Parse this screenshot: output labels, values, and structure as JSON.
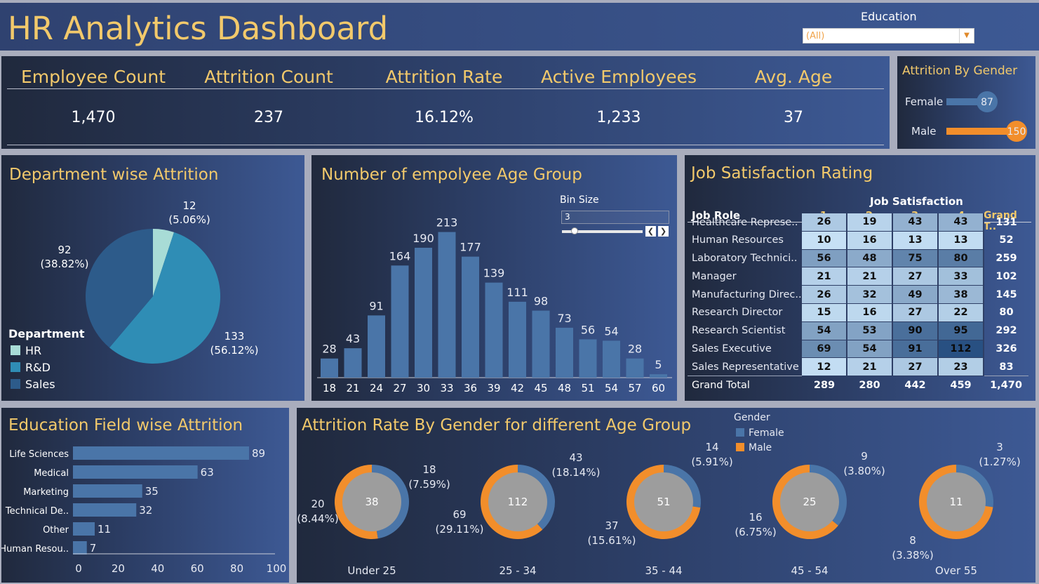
{
  "header": {
    "title": "HR Analytics Dashboard",
    "education_filter": {
      "label": "Education",
      "value": "(All)"
    }
  },
  "kpis": [
    {
      "label": "Employee Count",
      "value": "1,470"
    },
    {
      "label": "Attrition Count",
      "value": "237"
    },
    {
      "label": "Attrition Rate",
      "value": "16.12%"
    },
    {
      "label": "Active Employees",
      "value": "1,233"
    },
    {
      "label": "Avg. Age",
      "value": "37"
    }
  ],
  "attrition_by_gender": {
    "title": "Attrition By Gender",
    "items": [
      {
        "label": "Female",
        "value": 87
      },
      {
        "label": "Male",
        "value": 150
      }
    ],
    "colors": {
      "Female": "#4a75a8",
      "Male": "#f28e2b"
    }
  },
  "department": {
    "title": "Department wise Attrition",
    "legend_title": "Department",
    "chart_data": {
      "type": "pie",
      "categories": [
        "HR",
        "R&D",
        "Sales"
      ],
      "values": [
        12,
        133,
        92
      ],
      "labels": [
        "12",
        "133",
        "92"
      ],
      "percents": [
        "(5.06%)",
        "(56.12%)",
        "(38.82%)"
      ],
      "colors": [
        "#a8dcd6",
        "#2f8db5",
        "#2d5b8a"
      ]
    }
  },
  "age_group": {
    "title": "Number of empolyee Age Group",
    "bin_size": {
      "label": "Bin Size",
      "value": "3"
    },
    "chart_data": {
      "type": "bar",
      "categories": [
        "18",
        "21",
        "24",
        "27",
        "30",
        "33",
        "36",
        "39",
        "42",
        "45",
        "48",
        "51",
        "54",
        "57",
        "60"
      ],
      "values": [
        28,
        43,
        91,
        164,
        190,
        213,
        177,
        139,
        111,
        98,
        73,
        56,
        54,
        28,
        5
      ],
      "ylim": [
        0,
        230
      ],
      "color": "#4a75a8"
    }
  },
  "job_satisfaction": {
    "title": "Job Satisfaction Rating",
    "column_group": "Job Satisfaction",
    "row_header": "Job Role",
    "columns": [
      "1",
      "2",
      "3",
      "4",
      "Grand T.."
    ],
    "rows": [
      {
        "role": "Healthcare Represe..",
        "values": [
          "26",
          "19",
          "43",
          "43"
        ],
        "total": "131"
      },
      {
        "role": "Human Resources",
        "values": [
          "10",
          "16",
          "13",
          "13"
        ],
        "total": "52"
      },
      {
        "role": "Laboratory Technici..",
        "values": [
          "56",
          "48",
          "75",
          "80"
        ],
        "total": "259"
      },
      {
        "role": "Manager",
        "values": [
          "21",
          "21",
          "27",
          "33"
        ],
        "total": "102"
      },
      {
        "role": "Manufacturing Direc..",
        "values": [
          "26",
          "32",
          "49",
          "38"
        ],
        "total": "145"
      },
      {
        "role": "Research Director",
        "values": [
          "15",
          "16",
          "27",
          "22"
        ],
        "total": "80"
      },
      {
        "role": "Research Scientist",
        "values": [
          "54",
          "53",
          "90",
          "95"
        ],
        "total": "292"
      },
      {
        "role": "Sales Executive",
        "values": [
          "69",
          "54",
          "91",
          "112"
        ],
        "total": "326"
      },
      {
        "role": "Sales Representative",
        "values": [
          "12",
          "21",
          "27",
          "23"
        ],
        "total": "83"
      }
    ],
    "grand_total": {
      "label": "Grand Total",
      "values": [
        "289",
        "280",
        "442",
        "459"
      ],
      "total": "1,470"
    }
  },
  "education_field": {
    "title": "Education Field wise Attrition",
    "chart_data": {
      "type": "bar",
      "orientation": "horizontal",
      "categories": [
        "Life Sciences",
        "Medical",
        "Marketing",
        "Technical De..",
        "Other",
        "Human Resou.."
      ],
      "values": [
        89,
        63,
        35,
        32,
        11,
        7
      ],
      "xlim": [
        0,
        100
      ],
      "ticks": [
        "0",
        "20",
        "40",
        "60",
        "80",
        "100"
      ],
      "color": "#4a75a8"
    }
  },
  "age_gender": {
    "title": "Attrition Rate By Gender for different Age Group",
    "legend": {
      "title": "Gender",
      "items": [
        "Female",
        "Male"
      ]
    },
    "chart_data": {
      "type": "pie",
      "groups": [
        {
          "name": "Under 25",
          "total": "38",
          "female": 18,
          "female_pct": "(7.59%)",
          "male": 20,
          "male_pct": "(8.44%)"
        },
        {
          "name": "25 - 34",
          "total": "112",
          "female": 43,
          "female_pct": "(18.14%)",
          "male": 69,
          "male_pct": "(29.11%)"
        },
        {
          "name": "35 - 44",
          "total": "51",
          "female": 14,
          "female_pct": "(5.91%)",
          "male": 37,
          "male_pct": "(15.61%)"
        },
        {
          "name": "45 - 54",
          "total": "25",
          "female": 9,
          "female_pct": "(3.80%)",
          "male": 16,
          "male_pct": "(6.75%)"
        },
        {
          "name": "Over 55",
          "total": "11",
          "female": 3,
          "female_pct": "(1.27%)",
          "male": 8,
          "male_pct": "(3.38%)"
        }
      ]
    }
  }
}
